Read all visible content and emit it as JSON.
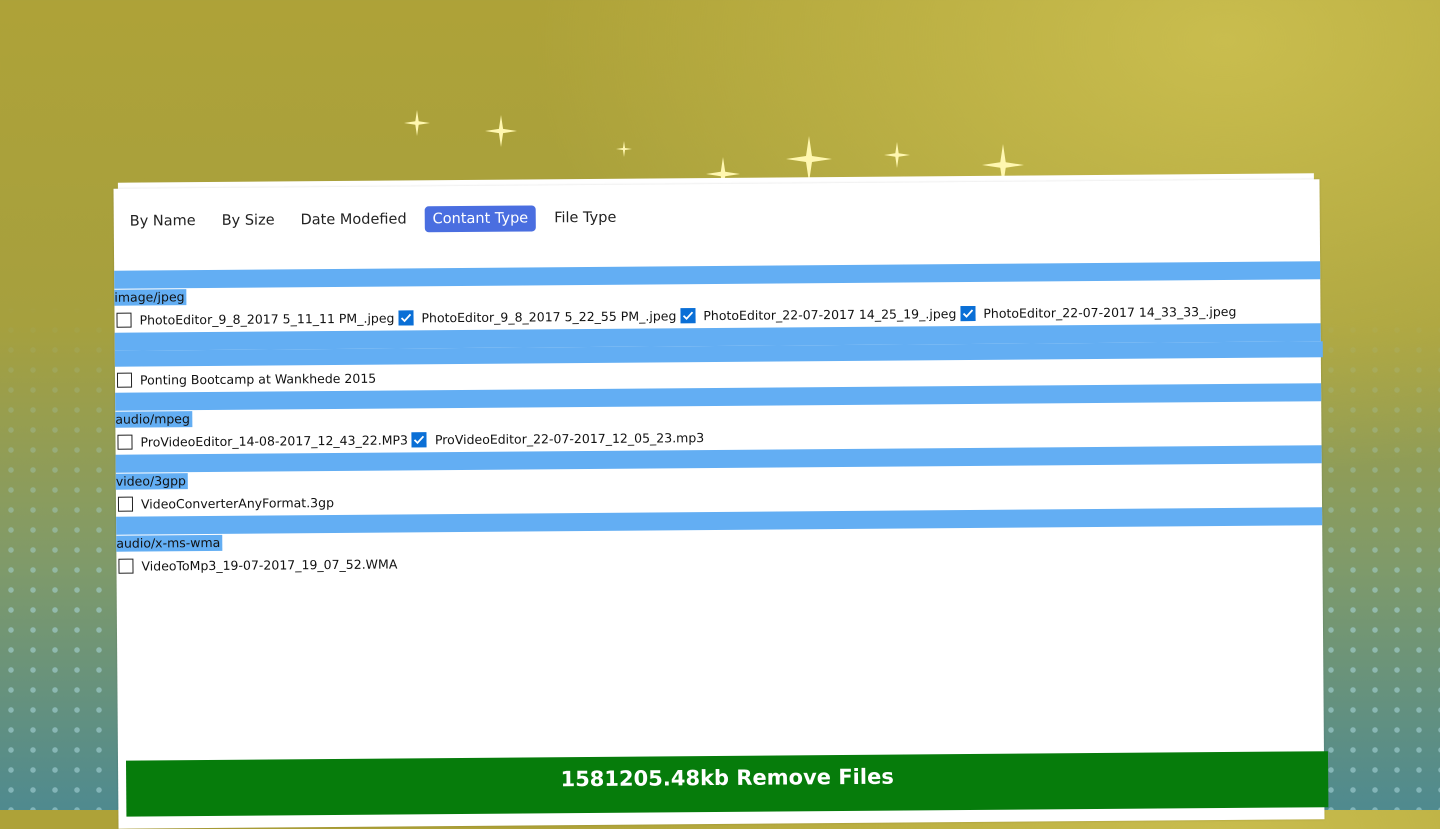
{
  "sort_tabs": [
    {
      "label": "By Name",
      "active": false
    },
    {
      "label": "By Size",
      "active": false
    },
    {
      "label": "Date Modefied",
      "active": false
    },
    {
      "label": "Contant Type",
      "active": true
    },
    {
      "label": "File Type",
      "active": false
    }
  ],
  "groups": [
    {
      "label": "image/jpeg",
      "files": [
        {
          "name": "PhotoEditor_9_8_2017 5_11_11 PM_.jpeg",
          "checked": false
        },
        {
          "name": "PhotoEditor_9_8_2017 5_22_55 PM_.jpeg",
          "checked": true
        },
        {
          "name": "PhotoEditor_22-07-2017 14_25_19_.jpeg",
          "checked": true
        },
        {
          "name": "PhotoEditor_22-07-2017 14_33_33_.jpeg",
          "checked": true
        }
      ]
    },
    {
      "label": "",
      "files": [
        {
          "name": "Ponting Bootcamp at Wankhede 2015",
          "checked": false
        }
      ]
    },
    {
      "label": "audio/mpeg",
      "files": [
        {
          "name": "ProVideoEditor_14-08-2017_12_43_22.MP3",
          "checked": false
        },
        {
          "name": "ProVideoEditor_22-07-2017_12_05_23.mp3",
          "checked": true
        }
      ]
    },
    {
      "label": "video/3gpp",
      "files": [
        {
          "name": "VideoConverterAnyFormat.3gp",
          "checked": false
        }
      ]
    },
    {
      "label": "audio/x-ms-wma",
      "files": [
        {
          "name": "VideoToMp3_19-07-2017_19_07_52.WMA",
          "checked": false
        }
      ]
    }
  ],
  "footer": {
    "label": "1581205.48kb Remove Files"
  },
  "colors": {
    "group_bar": "#63aef3",
    "active_tab": "#4a6ee0",
    "checkbox_checked": "#0a6fd6",
    "remove_button": "#067c0b"
  }
}
